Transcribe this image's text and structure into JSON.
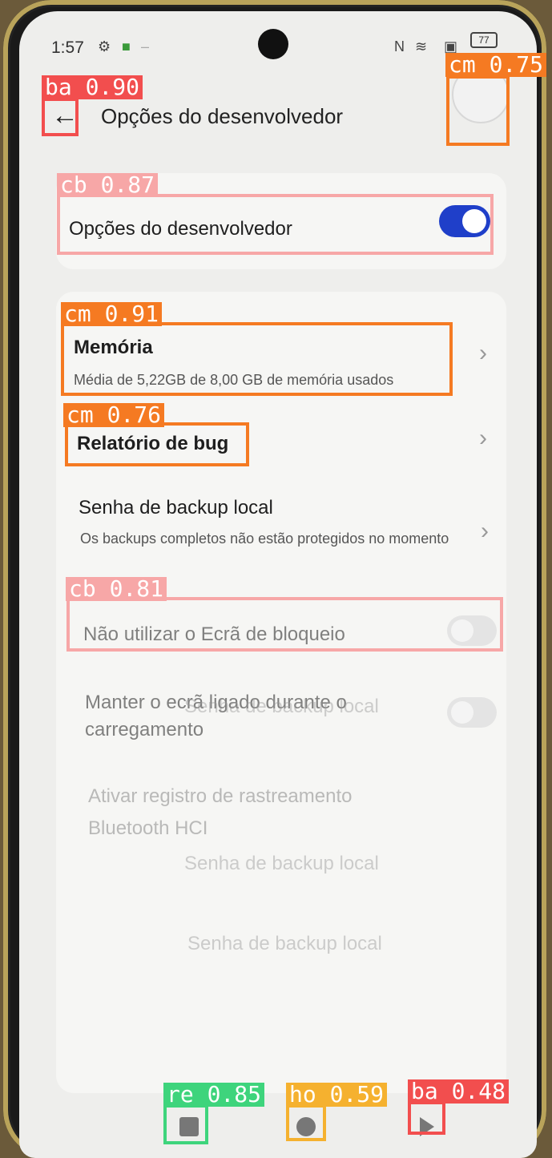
{
  "status": {
    "time": "1:57",
    "battery": "77"
  },
  "header": {
    "title": "Opções do desenvolvedor"
  },
  "master_toggle": {
    "label": "Opções do desenvolvedor",
    "enabled": true
  },
  "settings": [
    {
      "label": "Memória",
      "sub": "Média de 5,22GB de 8,00 GB de memória usados"
    },
    {
      "label": "Relatório de bug"
    },
    {
      "label": "Senha de backup local",
      "sub": "Os backups completos não estão protegidos no momento"
    },
    {
      "label": "Não utilizar o Ecrã de bloqueio"
    },
    {
      "label": "Manter o ecrã ligado durante o carregamento"
    },
    {
      "label": "Ativar registro de rastreamento Bluetooth HCI"
    }
  ],
  "ghost_texts": [
    "Senha de backup local",
    "Ativar registro de rastreamento",
    "Senha de backup local",
    "Senha de backup local"
  ],
  "detections": [
    {
      "tag": "ba 0.90",
      "color": "#f24e4e"
    },
    {
      "tag": "cm 0.75",
      "color": "#f57a22"
    },
    {
      "tag": "cb 0.87",
      "color": "#f7a7a7"
    },
    {
      "tag": "cm 0.91",
      "color": "#f57a22"
    },
    {
      "tag": "cm 0.76",
      "color": "#f57a22"
    },
    {
      "tag": "cb 0.81",
      "color": "#f7a7a7"
    },
    {
      "tag": "re 0.85",
      "color": "#3ed47c"
    },
    {
      "tag": "ho 0.59",
      "color": "#f5b12f"
    },
    {
      "tag": "ba 0.48",
      "color": "#f24e4e"
    }
  ]
}
